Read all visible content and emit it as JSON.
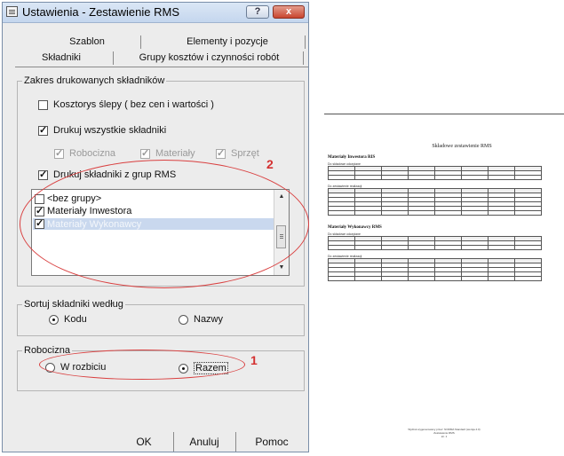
{
  "window": {
    "title": "Ustawienia - Zestawienie RMS",
    "help_glyph": "?",
    "close_glyph": "x"
  },
  "tabs": {
    "row1": [
      "Szablon",
      "Elementy i pozycje"
    ],
    "row2": [
      "Składniki",
      "Grupy kosztów i czynności robót"
    ]
  },
  "range_group": {
    "label": "Zakres drukowanych składników",
    "blind_estimate": "Kosztorys ślepy ( bez cen i wartości )",
    "print_all": "Drukuj wszystkie składniki",
    "sub_options": [
      "Robocizna",
      "Materiały",
      "Sprzęt"
    ],
    "print_rms_groups": "Drukuj składniki z grup RMS"
  },
  "group_list": {
    "items": [
      {
        "label": "<bez grupy>",
        "checked": false
      },
      {
        "label": "Materiały Inwestora",
        "checked": true
      },
      {
        "label": "Materiały Wykonawcy",
        "checked": true,
        "selected": true
      }
    ],
    "scroll_up": "▲",
    "scroll_down": "▼"
  },
  "sort_group": {
    "label": "Sortuj składniki według",
    "options": [
      "Kodu",
      "Nazwy"
    ],
    "selected": "Kodu"
  },
  "labor_group": {
    "label": "Robocizna",
    "options": [
      "W rozbiciu",
      "Razem"
    ],
    "selected": "Razem"
  },
  "annotations": {
    "one": "1",
    "two": "2"
  },
  "buttons": {
    "ok": "OK",
    "cancel": "Anuluj",
    "help": "Pomoc"
  },
  "colors": {
    "annotation": "#d94040",
    "selection": "#c9d8ee",
    "close_button": "#c8452f"
  },
  "document_preview": {
    "title": "Składowe zestawienie RMS",
    "sections": [
      {
        "heading": "Materiały Inwestora RIS",
        "sub1": "Do składowe odczytane",
        "sub2": "Do zestawienie realizacji"
      },
      {
        "heading": "Materiały Wykonawcy RMS",
        "sub1": "Do składowe odczytane",
        "sub2": "Do zestawienie realizacji"
      }
    ],
    "footer_lines": [
      "Wydruk wygenerowany przez: NORMA Standard (wersja 4.0)",
      "Zestawienie RMS",
      "str. 1"
    ]
  }
}
